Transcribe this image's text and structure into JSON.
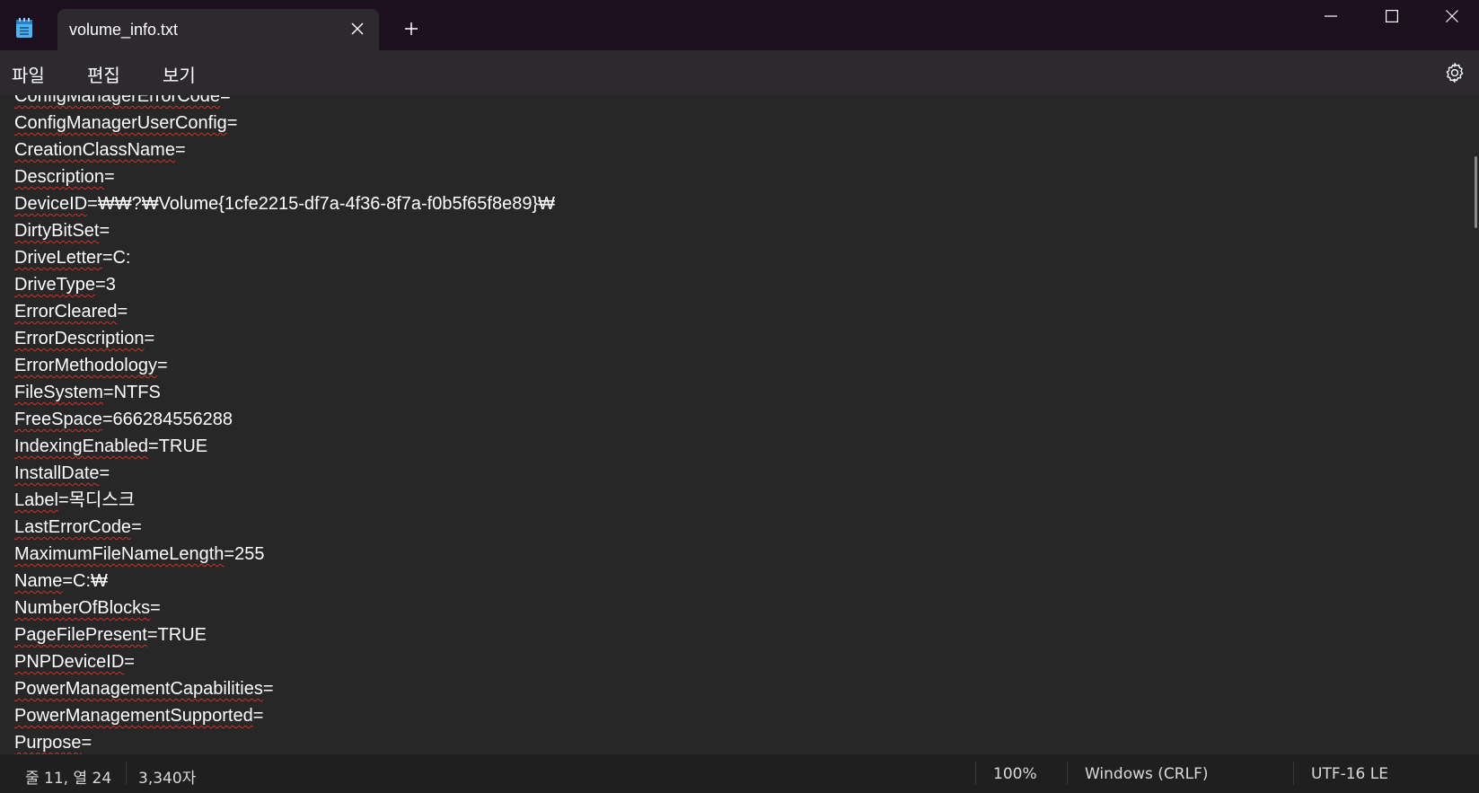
{
  "tab": {
    "title": "volume_info.txt"
  },
  "menu": {
    "file": "파일",
    "edit": "편집",
    "view": "보기"
  },
  "lines": [
    {
      "key": "ConfigManagerErrorCode",
      "rest": "="
    },
    {
      "key": "ConfigManagerUserConfig",
      "rest": "="
    },
    {
      "key": "CreationClassName",
      "rest": "="
    },
    {
      "key": "Description",
      "rest": "="
    },
    {
      "key": "DeviceID",
      "rest": "=₩₩?₩Volume{1cfe2215-df7a-4f36-8f7a-f0b5f65f8e89}₩"
    },
    {
      "key": "DirtyBitSet",
      "rest": "="
    },
    {
      "key": "DriveLetter",
      "rest": "=C:"
    },
    {
      "key": "DriveType",
      "rest": "=3"
    },
    {
      "key": "ErrorCleared",
      "rest": "="
    },
    {
      "key": "ErrorDescription",
      "rest": "="
    },
    {
      "key": "ErrorMethodology",
      "rest": "="
    },
    {
      "key": "FileSystem",
      "rest": "=NTFS"
    },
    {
      "key": "FreeSpace",
      "rest": "=666284556288"
    },
    {
      "key": "IndexingEnabled",
      "rest": "=TRUE"
    },
    {
      "key": "InstallDate",
      "rest": "="
    },
    {
      "key": "Label",
      "rest": "=목디스크"
    },
    {
      "key": "LastErrorCode",
      "rest": "="
    },
    {
      "key": "MaximumFileNameLength",
      "rest": "=255"
    },
    {
      "key": "Name",
      "rest": "=C:₩"
    },
    {
      "key": "NumberOfBlocks",
      "rest": "="
    },
    {
      "key": "PageFilePresent",
      "rest": "=TRUE"
    },
    {
      "key": "PNPDeviceID",
      "rest": "="
    },
    {
      "key": "PowerManagementCapabilities",
      "rest": "="
    },
    {
      "key": "PowerManagementSupported",
      "rest": "="
    },
    {
      "key": "Purpose",
      "rest": "="
    }
  ],
  "status": {
    "position": "줄 11, 열 24",
    "chars": "3,340자",
    "zoom": "100%",
    "line_ending": "Windows (CRLF)",
    "encoding": "UTF-16 LE"
  },
  "colors": {
    "titlebar": "#1c0f1e",
    "editor_bg": "#272727",
    "spell_underline": "#d0302e"
  },
  "icons": [
    "notepad-icon",
    "close-icon",
    "plus-icon",
    "minimize-icon",
    "maximize-icon",
    "gear-icon"
  ]
}
